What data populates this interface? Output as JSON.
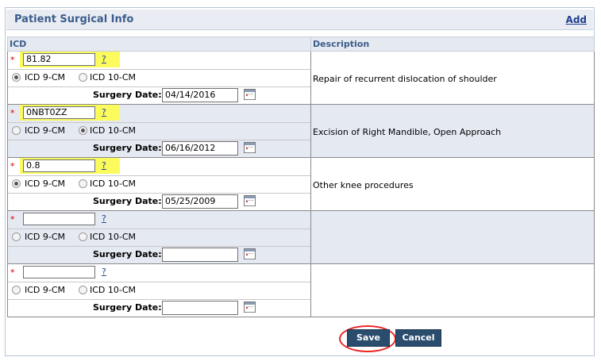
{
  "panel": {
    "title": "Patient Surgical Info",
    "add_label": "Add"
  },
  "columns": {
    "icd": "ICD",
    "description": "Description"
  },
  "labels": {
    "icd9": "ICD 9-CM",
    "icd10": "ICD 10-CM",
    "surgery_date": "Surgery Date:",
    "help": "?",
    "required": "*"
  },
  "rows": [
    {
      "code": "81.82",
      "selected": "icd9",
      "date": "04/14/2016",
      "description": "Repair of recurrent dislocation of shoulder",
      "highlighted": true
    },
    {
      "code": "0NBT0ZZ",
      "selected": "icd10",
      "date": "06/16/2012",
      "description": "Excision of Right Mandible, Open Approach",
      "highlighted": true
    },
    {
      "code": "0.8",
      "selected": "icd9",
      "date": "05/25/2009",
      "description": "Other knee procedures",
      "highlighted": true
    },
    {
      "code": "",
      "selected": "",
      "date": "",
      "description": "",
      "highlighted": false
    },
    {
      "code": "",
      "selected": "",
      "date": "",
      "description": "",
      "highlighted": false
    }
  ],
  "buttons": {
    "save": "Save",
    "cancel": "Cancel"
  },
  "colors": {
    "header_bg": "#e9edf3",
    "alt_row": "#e5e9f2",
    "highlight": "#fbfb5e",
    "button": "#2a4d6e",
    "annotation": "#e22222"
  }
}
